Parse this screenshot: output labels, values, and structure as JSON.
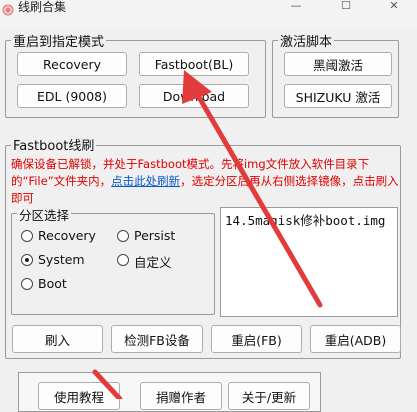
{
  "window": {
    "title": "线刷合集",
    "minimize": "—",
    "maximize": "☐",
    "close": "✕"
  },
  "reboot_group": {
    "label": "重启到指定模式",
    "buttons": [
      "Recovery",
      "Fastboot(BL)",
      "EDL (9008)",
      "Download"
    ]
  },
  "activate_group": {
    "label": "激活脚本",
    "buttons": [
      "黑阈激活",
      "SHIZUKU 激活"
    ]
  },
  "fastboot_group": {
    "label": "Fastboot线刷",
    "warn_part1": "确保设备已解锁，并处于Fastboot模式。先将img文件放入软件目录下的“File”文件夹内，",
    "warn_link": "点击此处刷新",
    "warn_part2": "，选定分区后再从右侧选择镜像，点击刷入即可",
    "partition_label": "分区选择",
    "partitions": [
      "Recovery",
      "Persist",
      "System",
      "自定义",
      "Boot"
    ],
    "selected_partition": "System",
    "image_list": [
      "14.5magisk修补boot.img"
    ],
    "actions": [
      "刷入",
      "检测FB设备",
      "重启(FB)",
      "重启(ADB)"
    ]
  },
  "bottom_buttons": [
    "使用教程",
    "捐赠作者",
    "关于/更新"
  ],
  "annotation_color": "#e23b3b"
}
